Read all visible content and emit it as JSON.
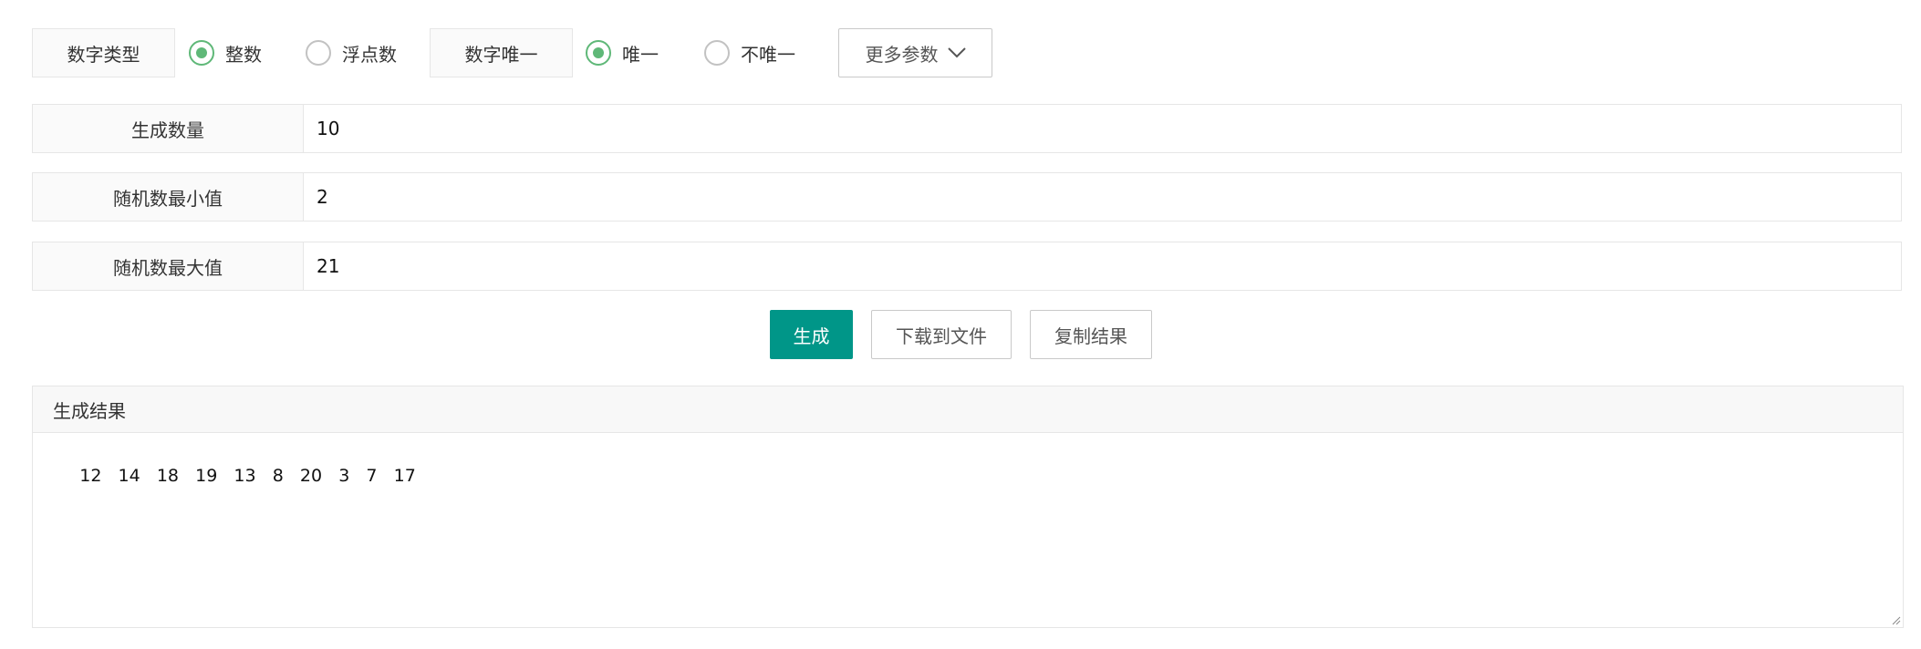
{
  "options": {
    "number_type_label": "数字类型",
    "integer_label": "整数",
    "float_label": "浮点数",
    "number_unique_label": "数字唯一",
    "unique_label": "唯一",
    "not_unique_label": "不唯一",
    "more_params_label": "更多参数",
    "selected_type": "integer",
    "selected_unique": "unique"
  },
  "fields": {
    "count": {
      "label": "生成数量",
      "value": "10"
    },
    "min": {
      "label": "随机数最小值",
      "value": "2"
    },
    "max": {
      "label": "随机数最大值",
      "value": "21"
    }
  },
  "buttons": {
    "generate": "生成",
    "download": "下载到文件",
    "copy": "复制结果"
  },
  "result": {
    "title": "生成结果",
    "content": "12   14   18   19   13   8   20   3   7   17"
  },
  "colors": {
    "primary": "#009688",
    "radio_checked": "#5FB878"
  },
  "icons": {
    "more_params": "chevron-down-icon",
    "resize": "resize-grip-icon"
  }
}
